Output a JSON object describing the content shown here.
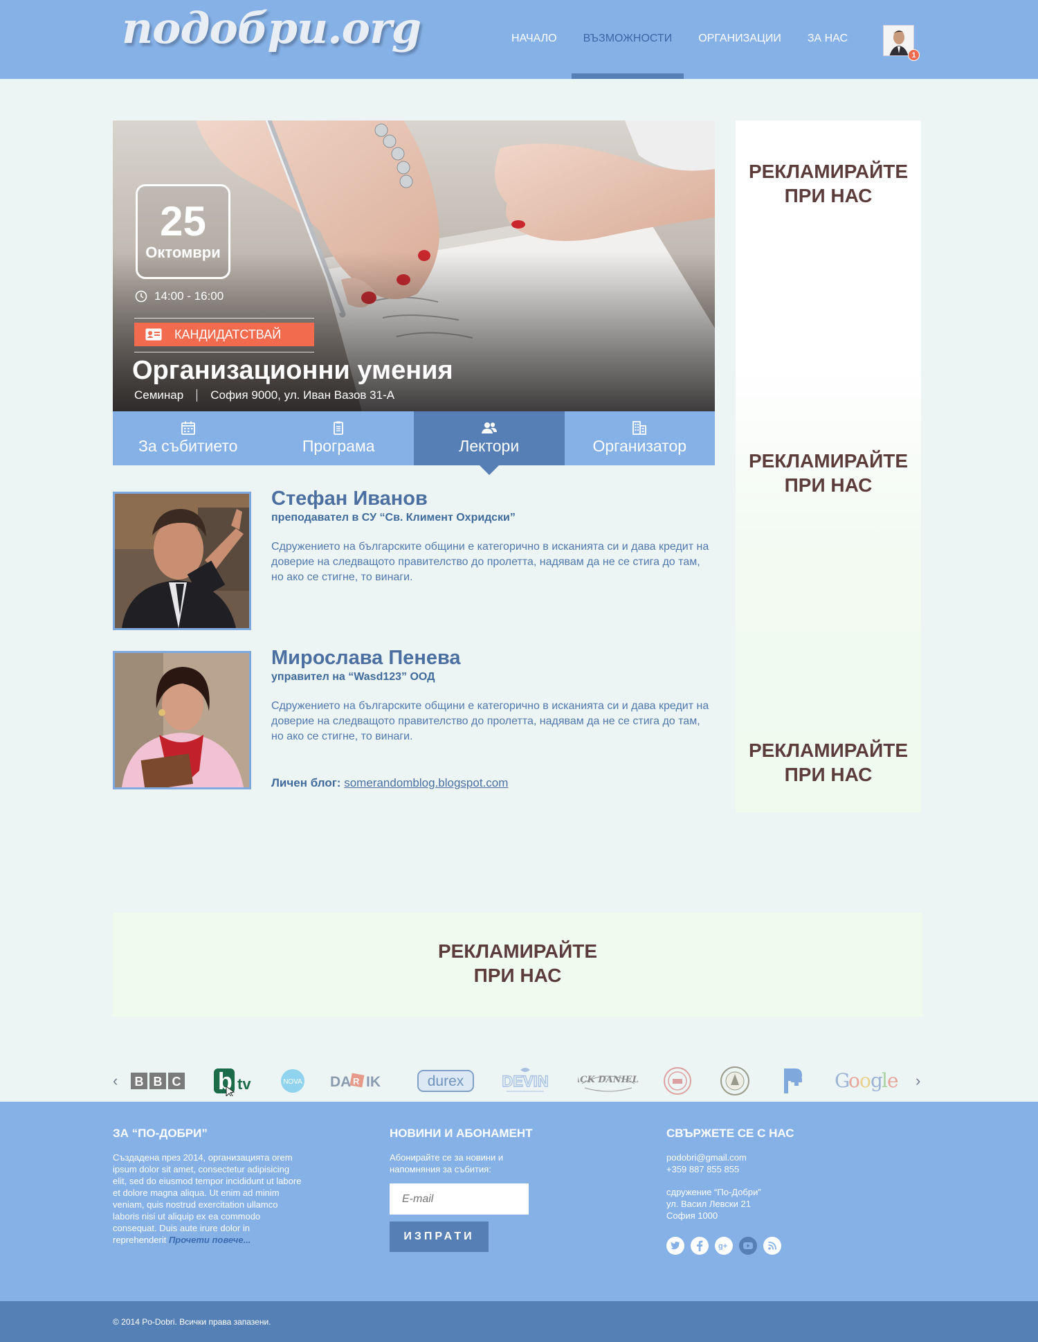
{
  "header": {
    "logo": "подобри.org",
    "nav": [
      {
        "label": "НАЧАЛО",
        "active": false
      },
      {
        "label": "ВЪЗМОЖНОСТИ",
        "active": true
      },
      {
        "label": "ОРГАНИЗАЦИИ",
        "active": false
      },
      {
        "label": "ЗА НАС",
        "active": false
      }
    ],
    "notification_count": "1"
  },
  "event": {
    "day": "25",
    "month": "Октомври",
    "time": "14:00 - 16:00",
    "apply_label": "КАНДИДАТСТВАЙ",
    "title": "Организационни умения",
    "type": "Семинар",
    "address": "София 9000, ул. Иван Вазов 31-А"
  },
  "tabs": [
    {
      "label": "За събитието",
      "icon": "calendar-icon",
      "active": false
    },
    {
      "label": "Програма",
      "icon": "clipboard-icon",
      "active": false
    },
    {
      "label": "Лектори",
      "icon": "people-icon",
      "active": true
    },
    {
      "label": "Организатор",
      "icon": "building-icon",
      "active": false
    }
  ],
  "lecturers": [
    {
      "name": "Стефан Иванов",
      "role": "преподавател в СУ “Св. Климент Охридски”",
      "bio": "Сдружението на българските общини е категорично в исканията си и дава кредит на доверие на следващото правителство до пролетта, надявам да не се стига до там, но ако се стигне, то винаги."
    },
    {
      "name": "Мирослава Пенева",
      "role": "управител на “Wasd123” ООД",
      "bio": "Сдружението на българските общини е категорично в исканията си и дава кредит на доверие на следващото правителство до пролетта, надявам да не се стига до там, но ако се стигне, то винаги.",
      "blog_label": "Личен блог:",
      "blog_url": "somerandomblog.blogspot.com"
    }
  ],
  "ads": {
    "line1": "РЕКЛАМИРАЙТЕ",
    "line2": "ПРИ НАС"
  },
  "partners": [
    "BBC",
    "btv",
    "NOVA",
    "DARIK",
    "durex",
    "DEVIN",
    "JACK DANIEL'S",
    "seal-1",
    "seal-2",
    "pharmacy",
    "Google"
  ],
  "footer": {
    "about": {
      "title": "ЗА “ПО-ДОБРИ”",
      "text": "Създадена през 2014, организацията orem ipsum dolor sit amet, consectetur adipisicing elit, sed do eiusmod tempor incididunt ut labore et dolore magna aliqua. Ut enim ad minim veniam, quis nostrud exercitation ullamco laboris nisi ut aliquip ex ea commodo consequat. Duis aute irure dolor in reprehenderit",
      "more": "Прочети повече..."
    },
    "news": {
      "title": "НОВИНИ И АБОНАМЕНТ",
      "text": "Абонирайте се за новини и напомняния за събития:",
      "placeholder": "E-mail",
      "button": "ИЗПРАТИ"
    },
    "contact": {
      "title": "СВЪРЖЕТЕ СЕ С НАС",
      "email": "podobri@gmail.com",
      "phone": "+359 887 855 855",
      "org": "сдружение “По-Добри”",
      "street": "ул. Васил Левски 21",
      "city": "София 1000"
    },
    "copyright": "© 2014 Po-Dobri. Всички права запазени."
  },
  "colors": {
    "header_bg": "#85b1e7",
    "accent_dark": "#557fb5",
    "apply_orange": "#f26b4e",
    "ad_text": "#5c3b3b"
  }
}
